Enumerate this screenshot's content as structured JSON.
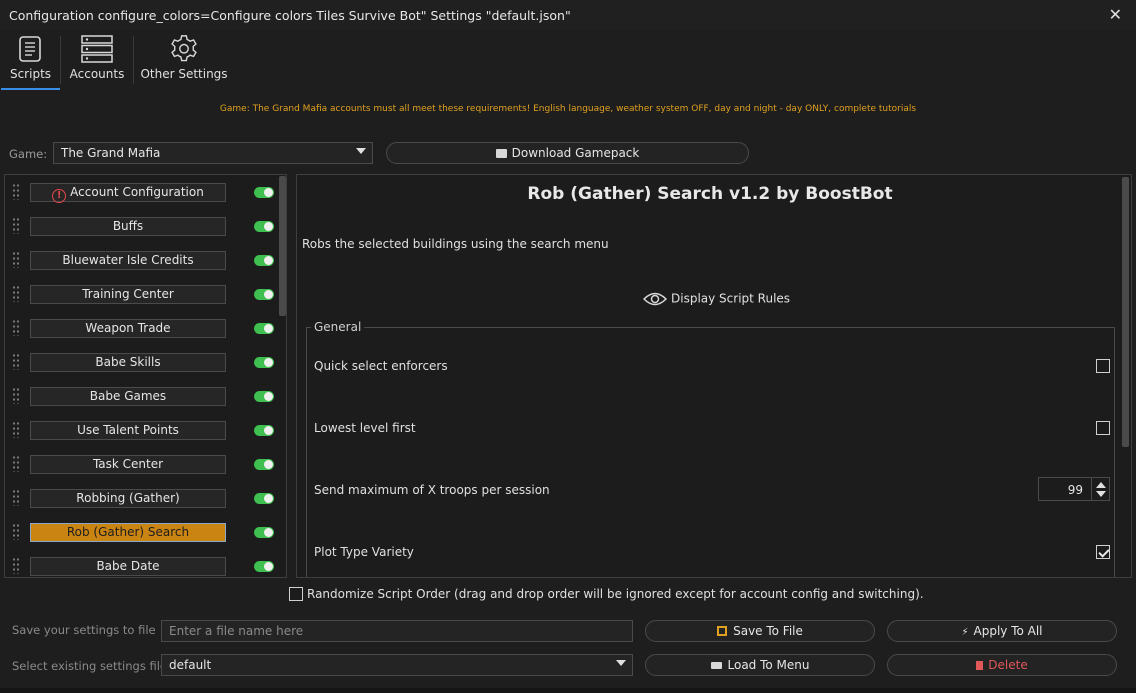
{
  "window": {
    "title": "Configuration configure_colors=Configure colors Tiles Survive Bot\" Settings \"default.json\"",
    "close_glyph": "✕"
  },
  "tabs": [
    {
      "label": "Scripts",
      "icon": "scroll-icon",
      "active": true
    },
    {
      "label": "Accounts",
      "icon": "server-icon",
      "active": false
    },
    {
      "label": "Other Settings",
      "icon": "gear-icon",
      "active": false
    }
  ],
  "notice": "Game: The Grand Mafia accounts must all meet these requirements! English language, weather system OFF, day and night - day ONLY, complete tutorials",
  "game": {
    "label": "Game:",
    "selected": "The Grand Mafia",
    "download_label": "Download Gamepack"
  },
  "scripts": [
    {
      "label": "Account Configuration",
      "warning": true,
      "enabled": true
    },
    {
      "label": "Buffs",
      "enabled": true
    },
    {
      "label": "Bluewater Isle Credits",
      "enabled": true
    },
    {
      "label": "Training Center",
      "enabled": true
    },
    {
      "label": "Weapon Trade",
      "enabled": true
    },
    {
      "label": "Babe Skills",
      "enabled": true
    },
    {
      "label": "Babe Games",
      "enabled": true
    },
    {
      "label": "Use Talent Points",
      "enabled": true
    },
    {
      "label": "Task Center",
      "enabled": true
    },
    {
      "label": "Robbing (Gather)",
      "enabled": true
    },
    {
      "label": "Rob (Gather) Search",
      "enabled": true,
      "active": true
    },
    {
      "label": "Babe Date",
      "enabled": true
    }
  ],
  "detail": {
    "title": "Rob (Gather) Search v1.2 by BoostBot",
    "description": "Robs the selected buildings using the search menu",
    "rules_label": "Display Script Rules",
    "group_label": "General",
    "options": {
      "quick_select": {
        "label": "Quick select enforcers",
        "checked": false
      },
      "lowest_level": {
        "label": "Lowest level first",
        "checked": false
      },
      "max_troops": {
        "label": "Send maximum of X troops per session",
        "value": "99"
      },
      "plot_variety": {
        "label": "Plot Type Variety",
        "checked": true
      }
    }
  },
  "randomize": {
    "label": "Randomize Script Order (drag and drop order will be ignored except for account config and switching).",
    "checked": false
  },
  "save": {
    "label": "Save your settings to file",
    "placeholder": "Enter a file name here",
    "save_button": "Save To File",
    "apply_button": "Apply To All"
  },
  "load": {
    "label": "Select existing settings file",
    "selected": "default",
    "load_button": "Load To Menu",
    "delete_button": "Delete"
  },
  "colors": {
    "accent": "#c98412",
    "toggle_on": "#3fbf4f",
    "notice": "#e0a020",
    "danger": "#e05858",
    "tab_underline": "#3a8ee6"
  }
}
